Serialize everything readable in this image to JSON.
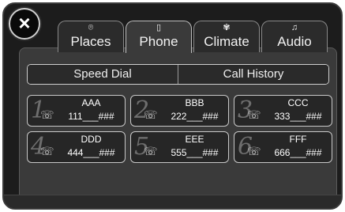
{
  "close_label": "×",
  "tabs": [
    {
      "icon": "⌾",
      "label": "Places",
      "active": false
    },
    {
      "icon": "▯",
      "label": "Phone",
      "active": true
    },
    {
      "icon": "✾",
      "label": "Climate",
      "active": false
    },
    {
      "icon": "♫",
      "label": "Audio",
      "active": false
    }
  ],
  "segments": {
    "left": "Speed Dial",
    "right": "Call History"
  },
  "speed_dial": [
    {
      "index": "1",
      "name": "AAA",
      "number": "111___###"
    },
    {
      "index": "2",
      "name": "BBB",
      "number": "222___###"
    },
    {
      "index": "3",
      "name": "CCC",
      "number": "333___###"
    },
    {
      "index": "4",
      "name": "DDD",
      "number": "444___###"
    },
    {
      "index": "5",
      "name": "EEE",
      "number": "555___###"
    },
    {
      "index": "6",
      "name": "FFF",
      "number": "666___###"
    }
  ],
  "colors": {
    "background": "#1c1c1c",
    "panel": "#3a3a3a",
    "text": "#ffffff"
  }
}
